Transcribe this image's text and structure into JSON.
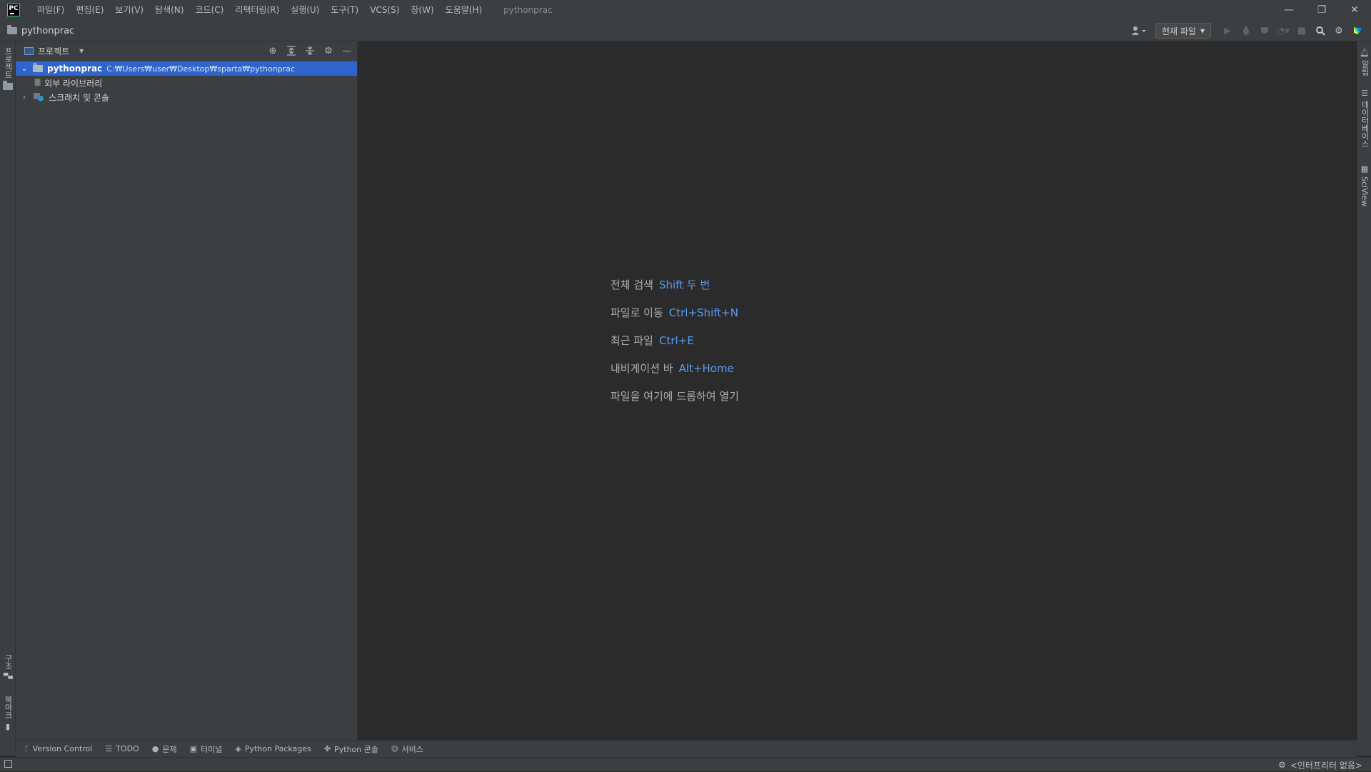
{
  "app": {
    "logo_text": "PC",
    "window_title": "pythonprac",
    "colors": {
      "bg": "#2b2b2b",
      "panel": "#3c3f41",
      "selection": "#2f65ca",
      "shortcut": "#589df6"
    }
  },
  "menu": [
    {
      "label": "파일(F)"
    },
    {
      "label": "편집(E)"
    },
    {
      "label": "보기(V)"
    },
    {
      "label": "탐색(N)"
    },
    {
      "label": "코드(C)"
    },
    {
      "label": "리팩터링(R)"
    },
    {
      "label": "실행(U)"
    },
    {
      "label": "도구(T)"
    },
    {
      "label": "VCS(S)"
    },
    {
      "label": "창(W)"
    },
    {
      "label": "도움말(H)"
    }
  ],
  "window_controls": {
    "minimize": "—",
    "restore": "❐",
    "close": "✕"
  },
  "navbar": {
    "breadcrumb": "pythonprac",
    "run_config": "현재 파일"
  },
  "left_strip": {
    "project": "프로젝트",
    "structure": "구조",
    "bookmarks": "북마크"
  },
  "right_strip": {
    "notifications": "알림",
    "database": "데이터베이스",
    "sciview": "SciView"
  },
  "project_panel": {
    "title": "프로젝트",
    "tree": [
      {
        "label": "pythonprac",
        "path": "C:₩Users₩user₩Desktop₩sparta₩pythonprac",
        "icon": "folder-icon",
        "expanded": true,
        "selected": true
      },
      {
        "label": "외부 라이브러리",
        "icon": "library-icon"
      },
      {
        "label": "스크래치 및 콘솔",
        "icon": "scratch-icon",
        "expanded": false
      }
    ]
  },
  "editor_hints": [
    {
      "text": "전체 검색",
      "shortcut": "Shift 두 번"
    },
    {
      "text": "파일로 이동",
      "shortcut": "Ctrl+Shift+N"
    },
    {
      "text": "최근 파일",
      "shortcut": "Ctrl+E"
    },
    {
      "text": "내비게이션 바",
      "shortcut": "Alt+Home"
    },
    {
      "text": "파일을 여기에 드롭하여 열기",
      "shortcut": ""
    }
  ],
  "bottom_tools": [
    {
      "label": "Version Control",
      "icon": "branch-icon"
    },
    {
      "label": "TODO",
      "icon": "todo-list-icon"
    },
    {
      "label": "문제",
      "icon": "problems-icon"
    },
    {
      "label": "터미널",
      "icon": "terminal-icon"
    },
    {
      "label": "Python Packages",
      "icon": "packages-icon"
    },
    {
      "label": "Python 콘솔",
      "icon": "python-console-icon"
    },
    {
      "label": "서비스",
      "icon": "services-icon"
    }
  ],
  "status": {
    "interpreter": "<인터프리터 없음>"
  }
}
